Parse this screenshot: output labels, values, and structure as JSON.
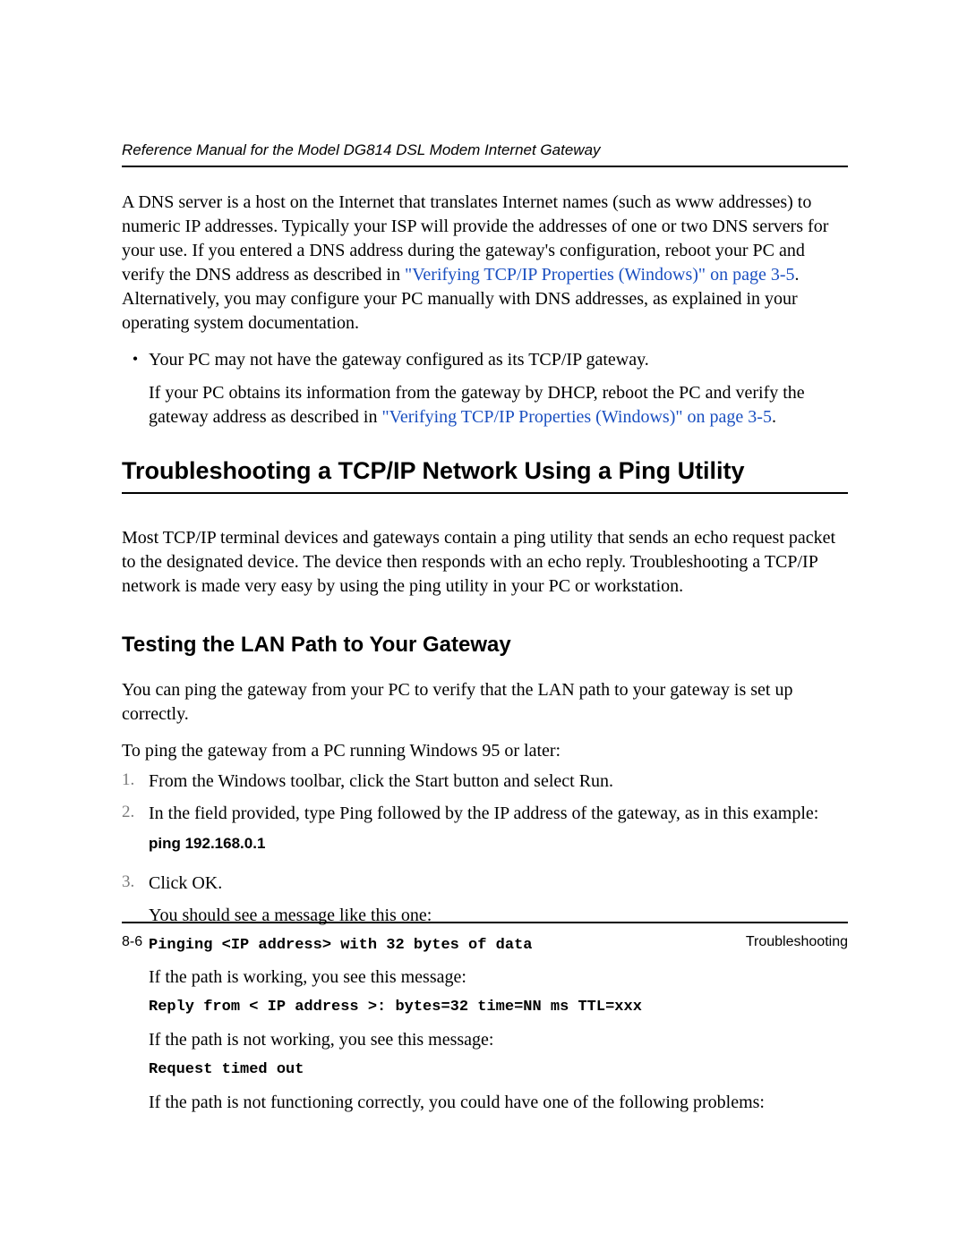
{
  "header": {
    "running_title": "Reference Manual for the Model DG814 DSL Modem Internet Gateway"
  },
  "intro": {
    "dns_para_a": "A DNS server is a host on the Internet that translates Internet names (such as www addresses) to numeric IP addresses. Typically your ISP will provide the addresses of one or two DNS servers for your use. If you entered a DNS address during the gateway's configuration, reboot your PC and verify the DNS address as described in ",
    "dns_link": "\"Verifying TCP/IP Properties (Windows)\" on page 3-5",
    "dns_para_b": ". Alternatively, you may configure your PC manually with DNS addresses, as explained in your operating system documentation.",
    "bullet_text": "Your PC may not have the gateway configured as its TCP/IP gateway.",
    "dhcp_para_a": "If your PC obtains its information from the gateway by DHCP, reboot the PC and verify the gateway address as described in ",
    "dhcp_link": "\"Verifying TCP/IP Properties (Windows)\" on page 3-5",
    "dhcp_para_b": "."
  },
  "section": {
    "title": "Troubleshooting a TCP/IP Network Using a Ping Utility",
    "intro": "Most TCP/IP terminal devices and gateways contain a ping utility that sends an echo request packet to the designated device. The device then responds with an echo reply. Troubleshooting a TCP/IP network is made very easy by using the ping utility in your PC or workstation."
  },
  "subsection": {
    "title": "Testing the LAN Path to Your Gateway",
    "lead": "You can ping the gateway from your PC to verify that the LAN path to your gateway is set up correctly.",
    "instr": "To ping the gateway from a PC running Windows 95 or later:"
  },
  "steps": {
    "s1": "From the Windows toolbar, click the Start button and select Run.",
    "s2": "In the field provided, type Ping followed by the IP address of the gateway, as in this example:",
    "s2_cmd": "ping 192.168.0.1",
    "s3": "Click OK.",
    "s3_p1": "You should see a message like this one:",
    "s3_m1": "Pinging <IP address> with 32 bytes of data",
    "s3_p2": "If the path is working, you see this message:",
    "s3_m2": "Reply from < IP address >: bytes=32 time=NN ms TTL=xxx",
    "s3_p3": "If the path is not working, you see this message:",
    "s3_m3": "Request timed out",
    "s3_p4": "If the path is not functioning correctly, you could have one of the following problems:"
  },
  "footer": {
    "page_num": "8-6",
    "chapter": "Troubleshooting"
  }
}
